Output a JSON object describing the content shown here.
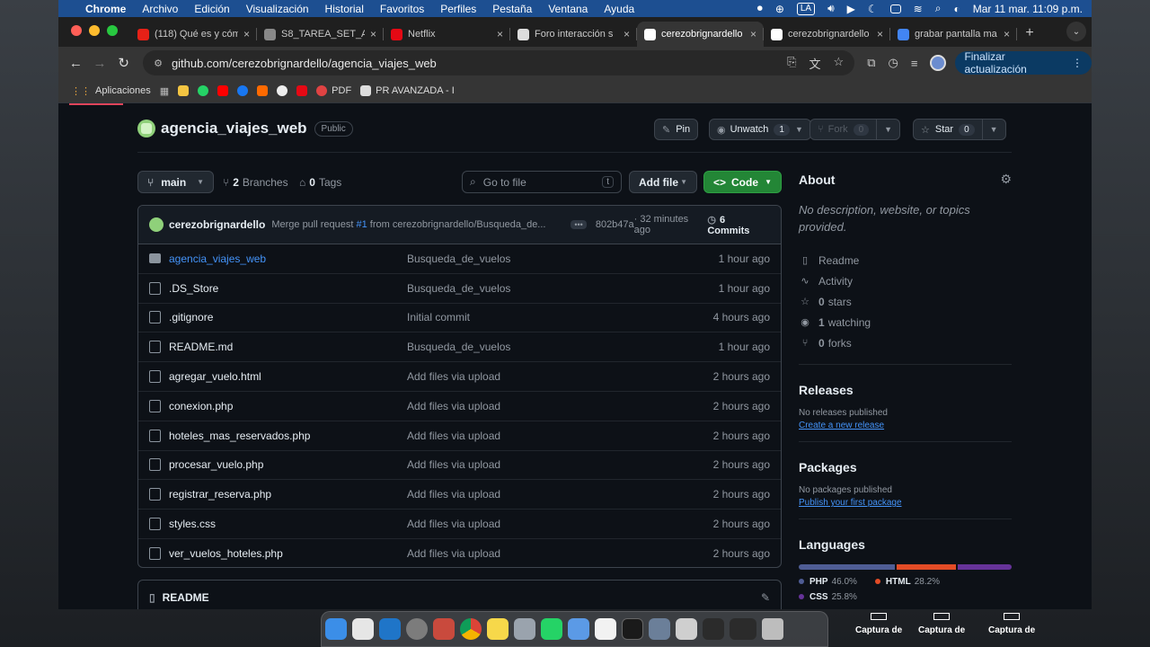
{
  "menubar": {
    "app": "Chrome",
    "items": [
      "Archivo",
      "Edición",
      "Visualización",
      "Historial",
      "Favoritos",
      "Perfiles",
      "Pestaña",
      "Ventana",
      "Ayuda"
    ],
    "input_source": "LA",
    "datetime": "Mar 11 mar.  11:09 p.m."
  },
  "tabs": [
    {
      "title": "(118) Qué es y cómo",
      "color": "#e62117",
      "icon": "youtube-icon"
    },
    {
      "title": "S8_TAREA_SET_A",
      "color": "#888888",
      "icon": "globe-icon"
    },
    {
      "title": "Netflix",
      "color": "#e50914",
      "icon": "netflix-icon"
    },
    {
      "title": "Foro interacción s",
      "color": "#dddddd",
      "icon": "uc-icon"
    },
    {
      "title": "cerezobrignardello",
      "color": "#ffffff",
      "icon": "github-icon",
      "active": true
    },
    {
      "title": "cerezobrignardello",
      "color": "#ffffff",
      "icon": "github-icon"
    },
    {
      "title": "grabar pantalla ma",
      "color": "#4285f4",
      "icon": "google-icon"
    }
  ],
  "toolbar": {
    "url": "github.com/cerezobrignardello/agencia_viajes_web",
    "update_label": "Finalizar actualización"
  },
  "bookmarks": {
    "apps": "Aplicaciones",
    "pdf": "PDF",
    "pr": "PR AVANZADA - I"
  },
  "repo": {
    "name": "agencia_viajes_web",
    "visibility": "Public",
    "pin": "Pin",
    "unwatch": "Unwatch",
    "unwatch_count": "1",
    "fork": "Fork",
    "fork_count": "0",
    "star": "Star",
    "star_count": "0"
  },
  "controls": {
    "branch": "main",
    "branches_count": "2",
    "branches_label": "Branches",
    "tags_count": "0",
    "tags_label": "Tags",
    "search_placeholder": "Go to file",
    "search_key": "t",
    "add_file": "Add file",
    "code": "Code"
  },
  "commit": {
    "author": "cerezobrignardello",
    "msg_prefix": "Merge pull request ",
    "pr": "#1",
    "msg_suffix": " from cerezobrignardello/Busqueda_de...",
    "hash": "802b47a",
    "time": " · 32 minutes ago",
    "count": "6 Commits"
  },
  "files": [
    {
      "name": "agencia_viajes_web",
      "msg": "Busqueda_de_vuelos",
      "time": "1 hour ago",
      "type": "dir"
    },
    {
      "name": ".DS_Store",
      "msg": "Busqueda_de_vuelos",
      "time": "1 hour ago",
      "type": "file"
    },
    {
      "name": ".gitignore",
      "msg": "Initial commit",
      "time": "4 hours ago",
      "type": "file"
    },
    {
      "name": "README.md",
      "msg": "Busqueda_de_vuelos",
      "time": "1 hour ago",
      "type": "file"
    },
    {
      "name": "agregar_vuelo.html",
      "msg": "Add files via upload",
      "time": "2 hours ago",
      "type": "file"
    },
    {
      "name": "conexion.php",
      "msg": "Add files via upload",
      "time": "2 hours ago",
      "type": "file"
    },
    {
      "name": "hoteles_mas_reservados.php",
      "msg": "Add files via upload",
      "time": "2 hours ago",
      "type": "file"
    },
    {
      "name": "procesar_vuelo.php",
      "msg": "Add files via upload",
      "time": "2 hours ago",
      "type": "file"
    },
    {
      "name": "registrar_reserva.php",
      "msg": "Add files via upload",
      "time": "2 hours ago",
      "type": "file"
    },
    {
      "name": "styles.css",
      "msg": "Add files via upload",
      "time": "2 hours ago",
      "type": "file"
    },
    {
      "name": "ver_vuelos_hoteles.php",
      "msg": "Add files via upload",
      "time": "2 hours ago",
      "type": "file"
    }
  ],
  "readme": "README",
  "about": {
    "title": "About",
    "description": "No description, website, or topics provided.",
    "readme": "Readme",
    "activity": "Activity",
    "stars_n": "0",
    "stars": "stars",
    "watching_n": "1",
    "watching": "watching",
    "forks_n": "0",
    "forks": "forks"
  },
  "releases": {
    "title": "Releases",
    "none": "No releases published",
    "link": "Create a new release"
  },
  "packages": {
    "title": "Packages",
    "none": "No packages published",
    "link": "Publish your first package"
  },
  "languages": {
    "title": "Languages",
    "items": [
      {
        "name": "PHP",
        "pct": 46.0,
        "label": "46.0%",
        "color": "#4f5d95"
      },
      {
        "name": "HTML",
        "pct": 28.2,
        "label": "28.2%",
        "color": "#e34c26"
      },
      {
        "name": "CSS",
        "pct": 25.8,
        "label": "25.8%",
        "color": "#663399"
      }
    ]
  },
  "desktop": {
    "capture": "Captura de"
  }
}
